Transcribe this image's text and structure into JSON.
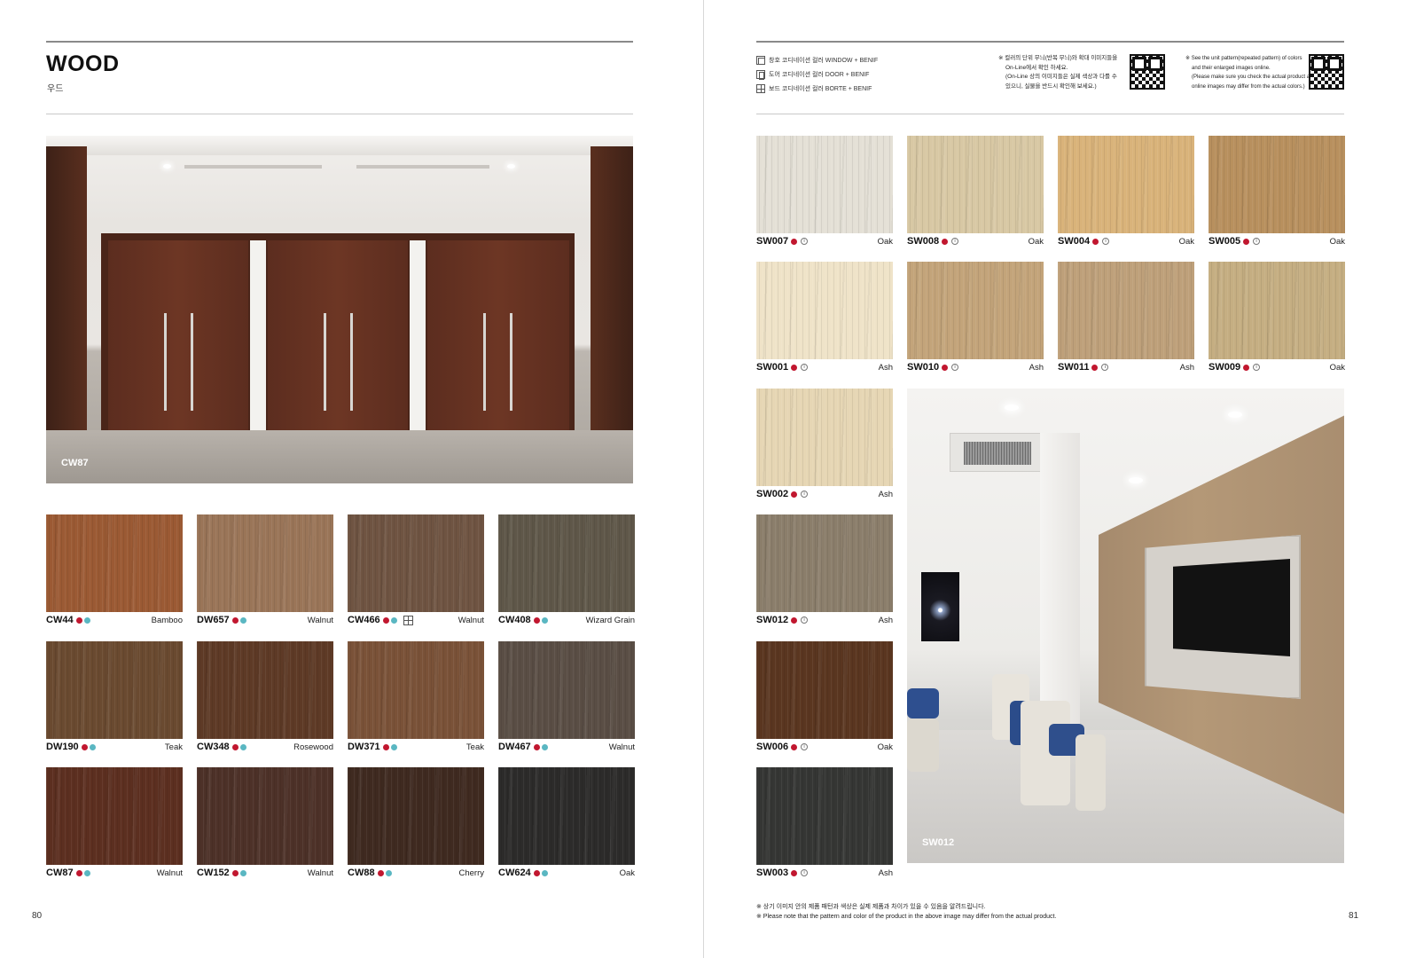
{
  "left_page": {
    "title": "WOOD",
    "subtitle": "우드",
    "hero_caption": "CW87",
    "page_number": "80",
    "swatches": [
      {
        "code": "CW44",
        "species": "Bamboo",
        "color": "#9b5a34",
        "dots": [
          "red",
          "teal"
        ]
      },
      {
        "code": "DW657",
        "species": "Walnut",
        "color": "#9a7558",
        "dots": [
          "red",
          "teal"
        ]
      },
      {
        "code": "CW466",
        "species": "Walnut",
        "color": "#6f5442",
        "dots": [
          "red",
          "teal"
        ],
        "board": true
      },
      {
        "code": "CW408",
        "species": "Wizard Grain",
        "color": "#5f5749",
        "dots": [
          "red",
          "teal"
        ]
      },
      {
        "code": "DW190",
        "species": "Teak",
        "color": "#6a4a30",
        "dots": [
          "red",
          "teal"
        ]
      },
      {
        "code": "CW348",
        "species": "Rosewood",
        "color": "#5e3a26",
        "dots": [
          "red",
          "teal"
        ]
      },
      {
        "code": "DW371",
        "species": "Teak",
        "color": "#7a5238",
        "dots": [
          "red",
          "teal"
        ]
      },
      {
        "code": "DW467",
        "species": "Walnut",
        "color": "#5a4e45",
        "dots": [
          "red",
          "teal"
        ]
      },
      {
        "code": "CW87",
        "species": "Walnut",
        "color": "#5c2f20",
        "dots": [
          "red",
          "teal"
        ]
      },
      {
        "code": "CW152",
        "species": "Walnut",
        "color": "#4d3128",
        "dots": [
          "red",
          "teal"
        ]
      },
      {
        "code": "CW88",
        "species": "Cherry",
        "color": "#3f2a20",
        "dots": [
          "red",
          "teal"
        ]
      },
      {
        "code": "CW624",
        "species": "Oak",
        "color": "#2c2b2a",
        "dots": [
          "red",
          "teal"
        ]
      }
    ]
  },
  "right_page": {
    "legend": [
      {
        "icon": "window-icon",
        "label": "창호 코디네이션 컬러 WINDOW + BENIF"
      },
      {
        "icon": "door-icon",
        "label": "도어 코디네이션 컬러 DOOR + BENIF"
      },
      {
        "icon": "board-icon",
        "label": "보드 코디네이션 컬러 BORTE + BENIF"
      }
    ],
    "note_kr": [
      "※ 컬러의 단위 무늬(반복 무늬)와 확대 이미지들을",
      "On-Line에서 확인 하세요.",
      "(On-Line 상의 이미지들은 실제 색상과 다를 수",
      "있으니, 실물을 반드시 확인해 보세요.)"
    ],
    "note_en": [
      "※ See the unit pattern(repeated pattern) of colors",
      "and their enlarged images online.",
      "(Please make sure you check the actual product as",
      "online images may differ from the actual colors.)"
    ],
    "swatches": [
      {
        "code": "SW007",
        "species": "Oak",
        "color": "#e4e0d6"
      },
      {
        "code": "SW008",
        "species": "Oak",
        "color": "#d8c8a4"
      },
      {
        "code": "SW004",
        "species": "Oak",
        "color": "#d9b37a"
      },
      {
        "code": "SW005",
        "species": "Oak",
        "color": "#b8905e"
      },
      {
        "code": "SW001",
        "species": "Ash",
        "color": "#efe3c8"
      },
      {
        "code": "SW010",
        "species": "Ash",
        "color": "#c3a47a"
      },
      {
        "code": "SW011",
        "species": "Ash",
        "color": "#bea07a"
      },
      {
        "code": "SW009",
        "species": "Oak",
        "color": "#c5ae82"
      },
      {
        "code": "SW002",
        "species": "Ash",
        "color": "#e6d6b4"
      },
      {
        "code": "SW012",
        "species": "Ash",
        "color": "#8b7e6b"
      },
      {
        "code": "SW006",
        "species": "Oak",
        "color": "#5a3620"
      },
      {
        "code": "SW003",
        "species": "Ash",
        "color": "#353634"
      }
    ],
    "interior_caption": "SW012",
    "footnote": [
      "※ 상기 이미지 안의 제품 패턴과 색상은 실제 제품과 차이가 있을 수 있음을 알려드립니다.",
      "※ Please note that the pattern and color of the product in the above image may differ from the actual product."
    ],
    "page_number": "81"
  }
}
